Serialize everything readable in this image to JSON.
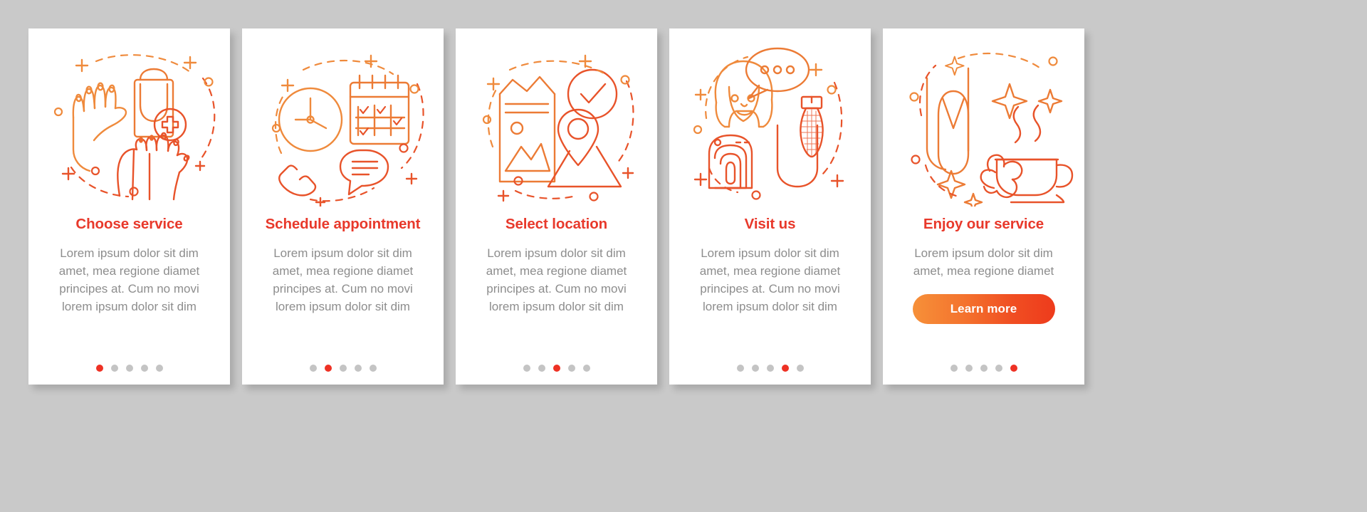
{
  "page": {
    "background_color": "#c9c9c9",
    "card_background": "#ffffff",
    "title_color": "#e8392b",
    "body_color": "#8d8d8d",
    "accent_orange": "#f07d33",
    "accent_red": "#e8452a",
    "dot_active_color": "#ee3124",
    "dot_inactive_color": "#c4c4c4"
  },
  "cards": [
    {
      "title": "Choose service",
      "body": "Lorem ipsum dolor sit dim amet, mea regione diamet principes at. Cum no movi lorem ipsum dolor sit dim",
      "illustration": "hand-nail-feet-icon",
      "active_dot": 0,
      "dot_count": 5
    },
    {
      "title": "Schedule appointment",
      "body": "Lorem ipsum dolor sit dim amet, mea regione diamet principes at. Cum no movi lorem ipsum dolor sit dim",
      "illustration": "clock-calendar-phone-icon",
      "active_dot": 1,
      "dot_count": 5
    },
    {
      "title": "Select location",
      "body": "Lorem ipsum dolor sit dim amet, mea regione diamet principes at. Cum no movi lorem ipsum dolor sit dim",
      "illustration": "brochure-check-map-pin-icon",
      "active_dot": 2,
      "dot_count": 5
    },
    {
      "title": "Visit us",
      "body": "Lorem ipsum dolor sit dim amet, mea regione diamet principes at. Cum no movi lorem ipsum dolor sit dim",
      "illustration": "woman-fingerprint-nail-drill-icon",
      "active_dot": 3,
      "dot_count": 5
    },
    {
      "title": "Enjoy our service",
      "body": "Lorem ipsum dolor sit dim amet, mea regione diamet",
      "illustration": "manicured-nail-tea-flower-icon",
      "active_dot": 4,
      "dot_count": 5,
      "button_label": "Learn more"
    }
  ]
}
